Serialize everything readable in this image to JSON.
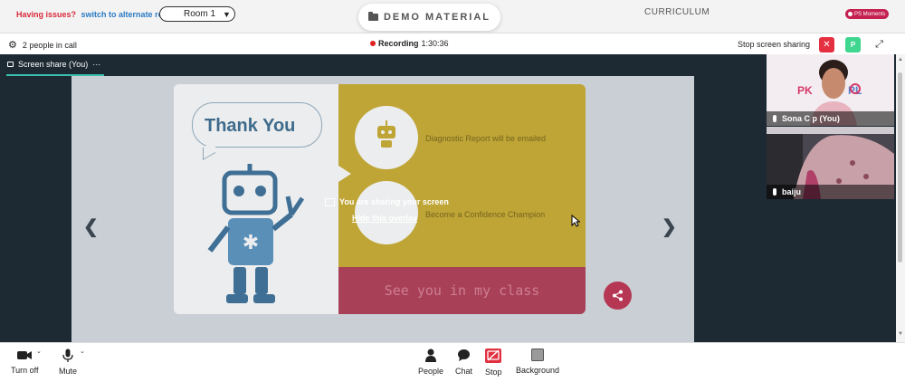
{
  "header": {
    "issues_text": "Having issues?",
    "alternate_link": "switch to alternate room",
    "room_value": "Room 1",
    "demo_button": "DEMO MATERIAL",
    "curriculum": "CURRICULUM",
    "moments_badge": "PS Moments"
  },
  "callbar": {
    "people_count": "2 people in call",
    "recording_label": "Recording",
    "recording_time": "1:30:36",
    "stop_sharing": "Stop screen sharing",
    "p_badge": "P"
  },
  "stage": {
    "share_tab": "Screen share (You)",
    "share_menu": "···"
  },
  "slide": {
    "thank_you": "Thank You",
    "diagnostic": "Diagnostic Report will be emailed",
    "confidence": "Become a Confidence Champion",
    "see_you": "See you in my class"
  },
  "overlay": {
    "message": "You are sharing your screen",
    "hide_link": "Hide this overlay"
  },
  "participants": [
    {
      "name": "Sona C p (You)"
    },
    {
      "name": "baiju"
    }
  ],
  "toolbar": {
    "turn_off": "Turn off",
    "mute": "Mute",
    "people": "People",
    "chat": "Chat",
    "stop": "Stop",
    "background": "Background"
  },
  "colors": {
    "accent_red": "#e53040",
    "stage_dark": "#1d2a33",
    "slide_yellow": "#bfa536",
    "slide_pink": "#a84058",
    "share_underline": "#3ac0b0"
  }
}
